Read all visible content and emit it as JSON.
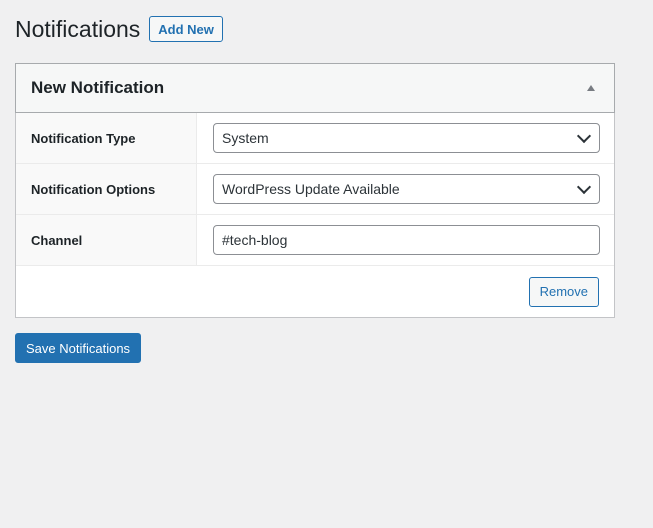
{
  "header": {
    "title": "Notifications",
    "add_new_label": "Add New"
  },
  "postbox": {
    "title": "New Notification",
    "toggle_icon": "triangle-up-icon",
    "rows": [
      {
        "label": "Notification Type",
        "value": "System"
      },
      {
        "label": "Notification Options",
        "value": "WordPress Update Available"
      },
      {
        "label": "Channel",
        "value": "#tech-blog"
      }
    ],
    "remove_label": "Remove"
  },
  "save_label": "Save Notifications",
  "colors": {
    "background": "#f0f0f1",
    "accent": "#2271b1",
    "panel": "#ffffff",
    "border": "#c3c4c7"
  }
}
